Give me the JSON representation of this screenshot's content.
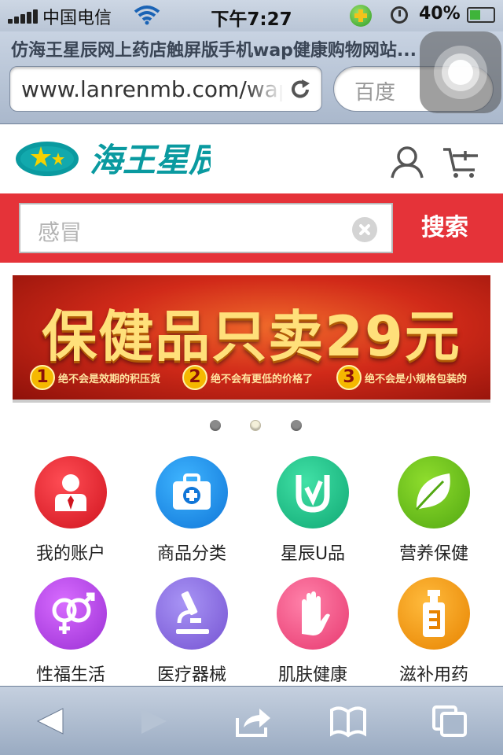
{
  "status_bar": {
    "carrier": "中国电信",
    "time": "下午7:27",
    "battery": "40%"
  },
  "browser": {
    "page_title": "仿海王星辰网上药店触屏版手机wap健康购物网站...",
    "url": "www.lanrenmb.com/wap",
    "search_placeholder": "百度"
  },
  "header": {
    "logo_text": "海王星辰"
  },
  "site_search": {
    "value": "感冒",
    "button_label": "搜索"
  },
  "banner": {
    "title": "保健品只卖29元",
    "points": [
      {
        "num": "1",
        "text": "绝不会是效期的积压货"
      },
      {
        "num": "2",
        "text": "绝不会有更低的价格了"
      },
      {
        "num": "3",
        "text": "绝不会是小规格包装的"
      }
    ]
  },
  "carousel": {
    "active_index": 1,
    "count": 3
  },
  "categories": [
    {
      "label": "我的账户",
      "icon": "account-icon",
      "color": "#e8232f"
    },
    {
      "label": "商品分类",
      "icon": "medical-kit-icon",
      "color": "#1a8ee8"
    },
    {
      "label": "星辰U品",
      "icon": "u-check-icon",
      "color": "#1ec48a"
    },
    {
      "label": "营养保健",
      "icon": "leaf-icon",
      "color": "#67c21d"
    },
    {
      "label": "性福生活",
      "icon": "gender-icon",
      "color": "#b548e8"
    },
    {
      "label": "医疗器械",
      "icon": "microscope-icon",
      "color": "#8c6be0"
    },
    {
      "label": "肌肤健康",
      "icon": "hand-icon",
      "color": "#f25b8e"
    },
    {
      "label": "滋补用药",
      "icon": "bottle-icon",
      "color": "#f39a11"
    }
  ],
  "colors": {
    "brand_red": "#e53339",
    "logo_teal": "#0a9aa0"
  }
}
